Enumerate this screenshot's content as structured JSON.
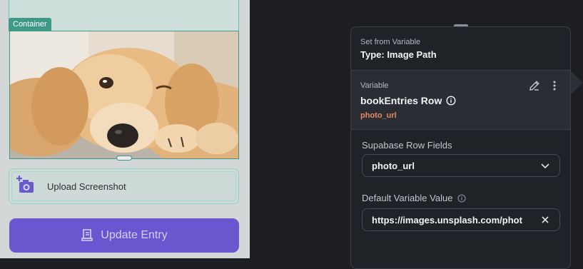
{
  "canvas": {
    "container_tag": "Container",
    "upload_label": "Upload Screenshot",
    "update_button_label": "Update Entry"
  },
  "panel": {
    "header_small": "Set from Variable",
    "header_title": "Type: Image Path",
    "variable_label": "Variable",
    "variable_name": "bookEntries Row",
    "variable_path": "photo_url",
    "row_fields_label": "Supabase Row Fields",
    "row_fields_value": "photo_url",
    "default_label": "Default Variable Value",
    "default_value": "https://images.unsplash.com/phot"
  },
  "colors": {
    "accent_teal": "#3f9987",
    "button_purple": "#6a57cf",
    "path_orange": "#e8875f"
  },
  "icons": [
    "add-photo-icon",
    "receipt-icon",
    "info-icon",
    "edit-icon",
    "more-vertical-icon",
    "chevron-down-icon",
    "close-icon"
  ]
}
